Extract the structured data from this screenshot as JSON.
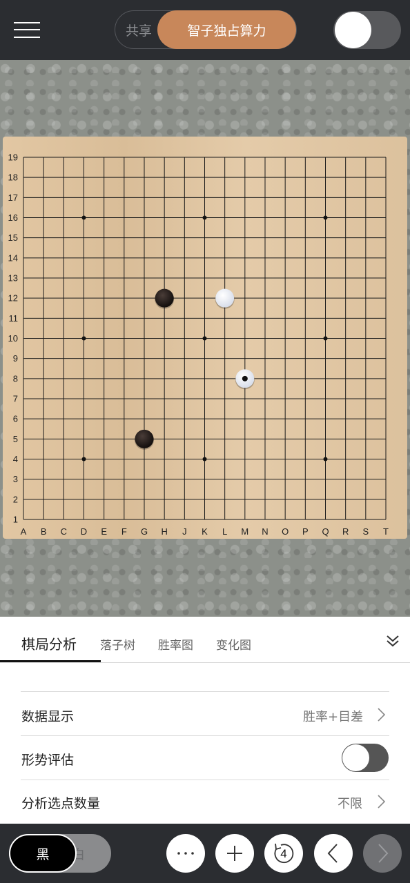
{
  "header": {
    "share_label": "共享",
    "exclusive_label": "智子独占算力",
    "toggle_state": "on"
  },
  "board": {
    "size": 19,
    "columns": [
      "A",
      "B",
      "C",
      "D",
      "E",
      "F",
      "G",
      "H",
      "J",
      "K",
      "L",
      "M",
      "N",
      "O",
      "P",
      "Q",
      "R",
      "S",
      "T"
    ],
    "rows": [
      "19",
      "18",
      "17",
      "16",
      "15",
      "14",
      "13",
      "12",
      "11",
      "10",
      "9",
      "8",
      "7",
      "6",
      "5",
      "4",
      "3",
      "2",
      "1"
    ],
    "star_points": [
      "D16",
      "K16",
      "Q16",
      "D10",
      "K10",
      "Q10",
      "D4",
      "K4",
      "Q4"
    ],
    "stones": [
      {
        "color": "black",
        "point": "H12"
      },
      {
        "color": "white",
        "point": "L12"
      },
      {
        "color": "white",
        "point": "M8",
        "last_move": true
      },
      {
        "color": "black",
        "point": "G5"
      }
    ]
  },
  "panel": {
    "tabs": [
      "棋局分析",
      "落子树",
      "胜率图",
      "变化图"
    ],
    "active_tab": "棋局分析",
    "rows": [
      {
        "label": "数据显示",
        "value": "胜率+目差"
      },
      {
        "label": "形势评估",
        "toggle": "off"
      },
      {
        "label": "分析选点数量",
        "value": "不限"
      }
    ]
  },
  "bottom": {
    "black_label": "黑",
    "white_label": "白",
    "undo_count": "4",
    "more_icon": "more-icon",
    "add_icon": "plus-icon",
    "prev_icon": "chevron-left-icon",
    "next_icon": "chevron-right-icon"
  }
}
